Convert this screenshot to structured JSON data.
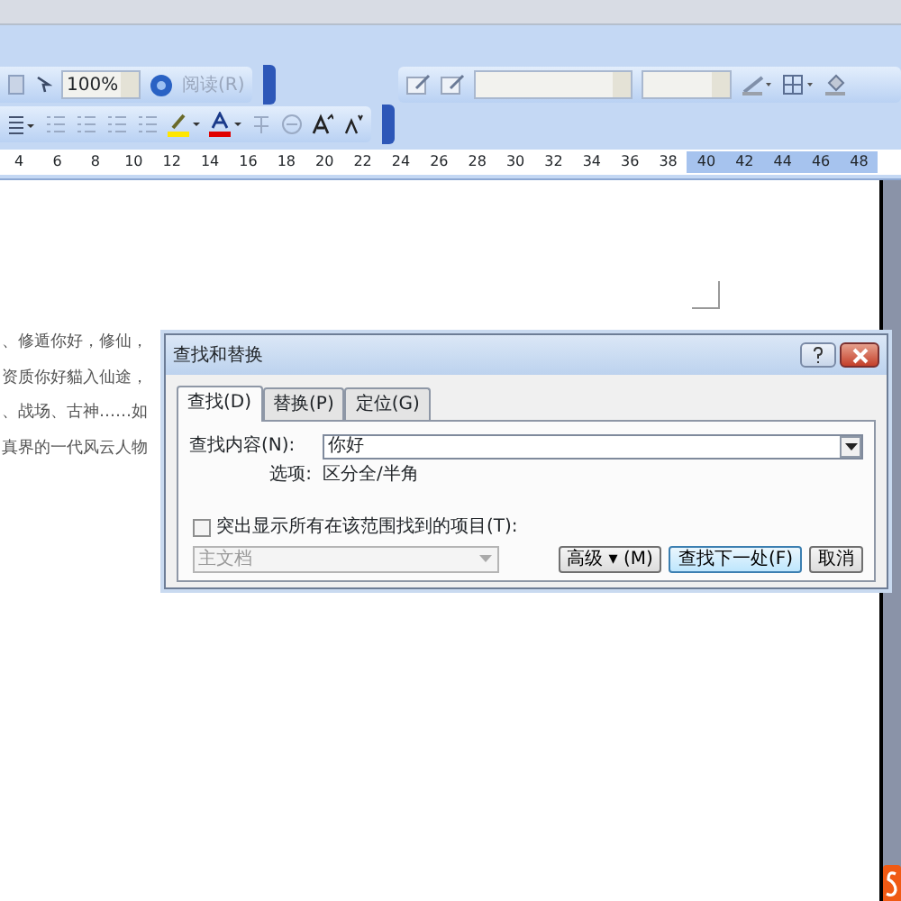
{
  "toolbar_top": {
    "zoom": "100%",
    "read_button": "阅读(R)"
  },
  "ruler": {
    "ticks": [
      {
        "label": "4",
        "in_margin": false
      },
      {
        "label": "6",
        "in_margin": false
      },
      {
        "label": "8",
        "in_margin": false
      },
      {
        "label": "10",
        "in_margin": false
      },
      {
        "label": "12",
        "in_margin": false
      },
      {
        "label": "14",
        "in_margin": false
      },
      {
        "label": "16",
        "in_margin": false
      },
      {
        "label": "18",
        "in_margin": false
      },
      {
        "label": "20",
        "in_margin": false
      },
      {
        "label": "22",
        "in_margin": false
      },
      {
        "label": "24",
        "in_margin": false
      },
      {
        "label": "26",
        "in_margin": false
      },
      {
        "label": "28",
        "in_margin": false
      },
      {
        "label": "30",
        "in_margin": false
      },
      {
        "label": "32",
        "in_margin": false
      },
      {
        "label": "34",
        "in_margin": false
      },
      {
        "label": "36",
        "in_margin": false
      },
      {
        "label": "38",
        "in_margin": false
      },
      {
        "label": "40",
        "in_margin": true
      },
      {
        "label": "42",
        "in_margin": true
      },
      {
        "label": "44",
        "in_margin": true
      },
      {
        "label": "46",
        "in_margin": true
      },
      {
        "label": "48",
        "in_margin": true
      }
    ]
  },
  "document": {
    "lines": [
      "、修遁你好，修仙，",
      "资质你好貓入仙途，",
      "、战场、古神……如",
      "真界的一代风云人物"
    ]
  },
  "dialog": {
    "title": "查找和替换",
    "tabs": [
      {
        "label": "查找(D)",
        "selected": true
      },
      {
        "label": "替换(P)",
        "selected": false
      },
      {
        "label": "定位(G)",
        "selected": false
      }
    ],
    "find_label": "查找内容(N):",
    "find_value": "你好",
    "options_label": "选项:",
    "options_value": "区分全/半角",
    "highlight": {
      "label": "突出显示所有在该范围找到的项目(T):",
      "checked": false
    },
    "scope": {
      "value": "主文档",
      "disabled": true
    },
    "buttons": [
      {
        "label": "高级 ▾ (M)",
        "default": false
      },
      {
        "label": "查找下一处(F)",
        "default": true
      },
      {
        "label": "取消",
        "default": false
      }
    ]
  }
}
